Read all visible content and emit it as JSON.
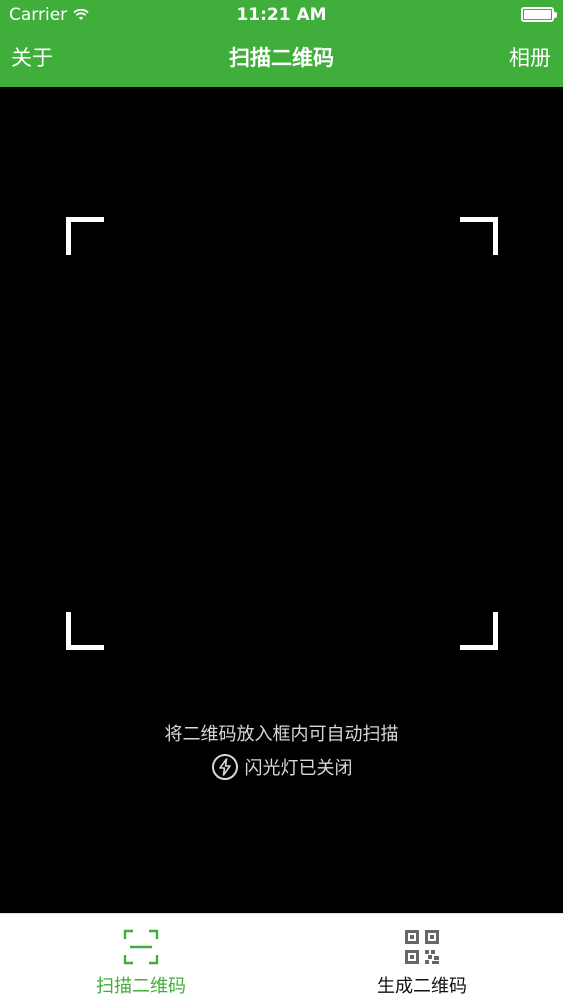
{
  "status": {
    "carrier": "Carrier",
    "time": "11:21 AM"
  },
  "navbar": {
    "left": "关于",
    "title": "扫描二维码",
    "right": "相册"
  },
  "scanner": {
    "hint": "将二维码放入框内可自动扫描",
    "flash_label": "闪光灯已关闭"
  },
  "tabbar": {
    "tabs": [
      {
        "label": "扫描二维码",
        "icon": "scan-frame-icon",
        "selected": true
      },
      {
        "label": "生成二维码",
        "icon": "qr-code-icon",
        "selected": false
      }
    ]
  },
  "colors": {
    "accent": "#3fae3a",
    "camera_background": "#000000"
  }
}
